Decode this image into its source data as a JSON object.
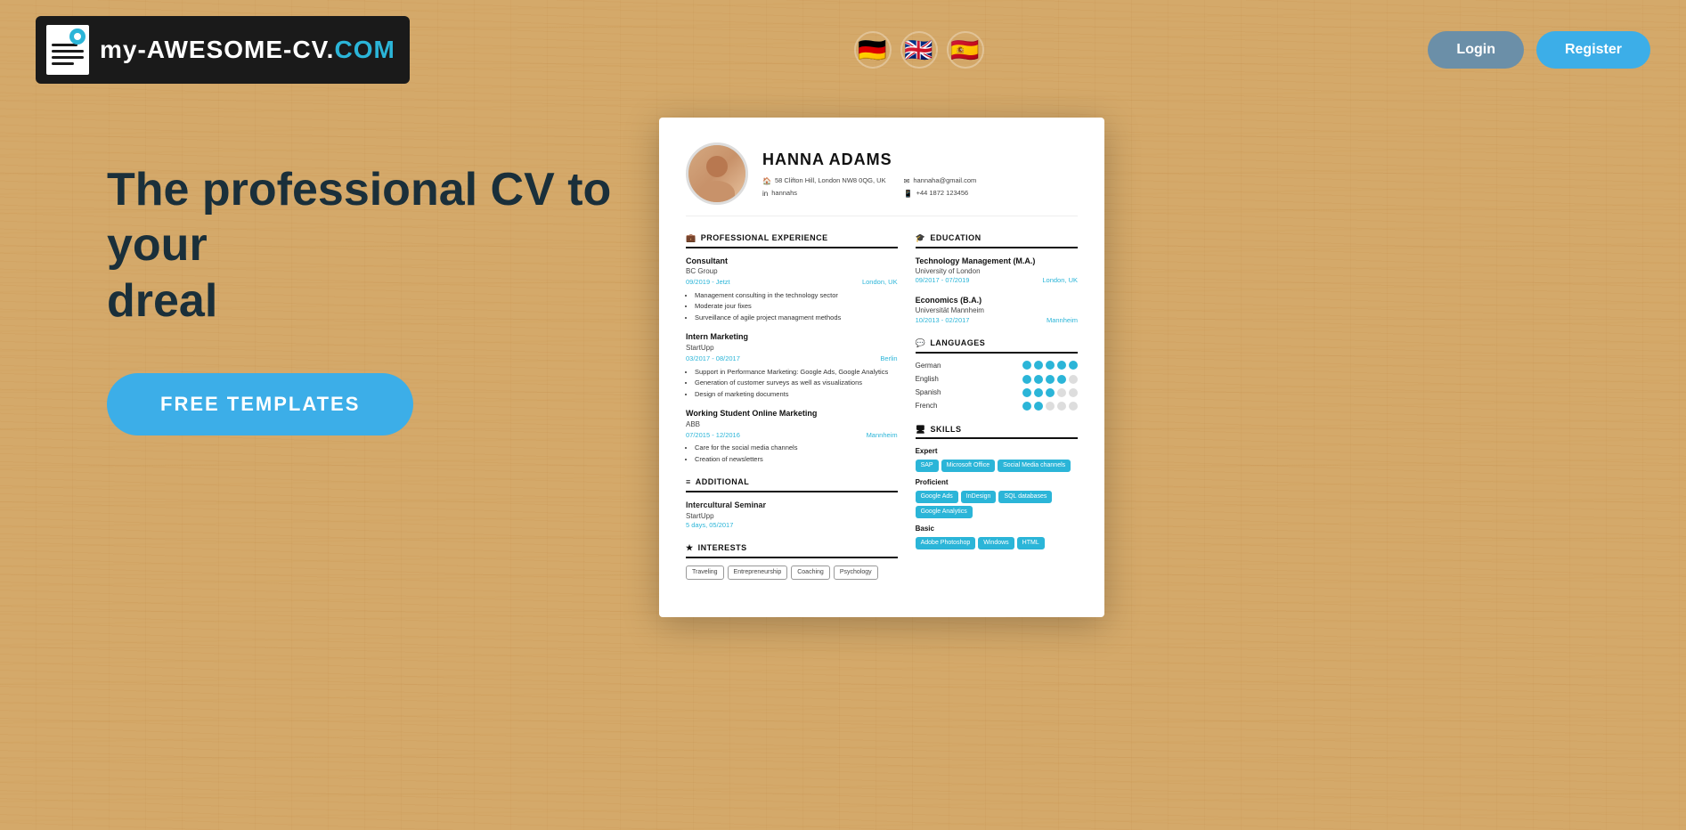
{
  "header": {
    "logo_text": "my-AWESOME-CV.",
    "logo_com": "COM",
    "login_label": "Login",
    "register_label": "Register",
    "languages": [
      {
        "name": "German",
        "emoji": "🇩🇪"
      },
      {
        "name": "English",
        "emoji": "🇬🇧"
      },
      {
        "name": "Spanish",
        "emoji": "🇪🇸"
      }
    ]
  },
  "hero": {
    "title_line1": "The professional CV to",
    "title_line2": "your",
    "title_line3": "dreal",
    "cta_label": "FREE TEMPLATES"
  },
  "cv": {
    "name": "HANNA ADAMS",
    "contact": {
      "address": "58 Clifton Hill, London NW8 0QG, UK",
      "linkedin": "hannahs",
      "email": "hannaha@gmail.com",
      "phone": "+44 1872 123456"
    },
    "professional_experience": {
      "section_title": "PROFESSIONAL EXPERIENCE",
      "jobs": [
        {
          "title": "Consultant",
          "company": "BC Group",
          "date": "09/2019 - Jetzt",
          "location": "London, UK",
          "bullets": [
            "Management consulting in the technology sector",
            "Moderate jour fixes",
            "Surveillance of agile project managment methods"
          ]
        },
        {
          "title": "Intern Marketing",
          "company": "StartUpp",
          "date": "03/2017 - 08/2017",
          "location": "Berlin",
          "bullets": [
            "Support in Performance Marketing: Google Ads, Google Analytics",
            "Generation of customer surveys as well as visualizations",
            "Design of marketing documents"
          ]
        },
        {
          "title": "Working Student Online Marketing",
          "company": "ABB",
          "date": "07/2015 - 12/2016",
          "location": "Mannheim",
          "bullets": [
            "Care for the social media channels",
            "Creation of newsletters"
          ]
        }
      ]
    },
    "additional": {
      "section_title": "ADDITIONAL",
      "items": [
        {
          "title": "Intercultural Seminar",
          "company": "StartUpp",
          "date": "5 days, 05/2017"
        }
      ]
    },
    "interests": {
      "section_title": "INTERESTS",
      "tags": [
        "Traveling",
        "Entrepreneurship",
        "Coaching",
        "Psychology"
      ]
    },
    "education": {
      "section_title": "EDUCATION",
      "items": [
        {
          "degree": "Technology Management (M.A.)",
          "university": "University of London",
          "date": "09/2017 - 07/2019",
          "location": "London, UK"
        },
        {
          "degree": "Economics (B.A.)",
          "university": "Universität Mannheim",
          "date": "10/2013 - 02/2017",
          "location": "Mannheim"
        }
      ]
    },
    "languages": {
      "section_title": "LANGUAGES",
      "items": [
        {
          "name": "German",
          "filled": 5,
          "total": 5
        },
        {
          "name": "English",
          "filled": 4,
          "total": 5
        },
        {
          "name": "Spanish",
          "filled": 3,
          "total": 5
        },
        {
          "name": "French",
          "filled": 2,
          "total": 5
        }
      ]
    },
    "skills": {
      "section_title": "SKILLS",
      "levels": [
        {
          "level": "Expert",
          "tags": [
            "SAP",
            "Microsoft Office",
            "Social Media channels"
          ]
        },
        {
          "level": "Proficient",
          "tags": [
            "Google Ads",
            "InDesign",
            "SQL databases",
            "Google Analytics"
          ]
        },
        {
          "level": "Basic",
          "tags": [
            "Adobe Photoshop",
            "Windows",
            "HTML"
          ]
        }
      ]
    }
  }
}
